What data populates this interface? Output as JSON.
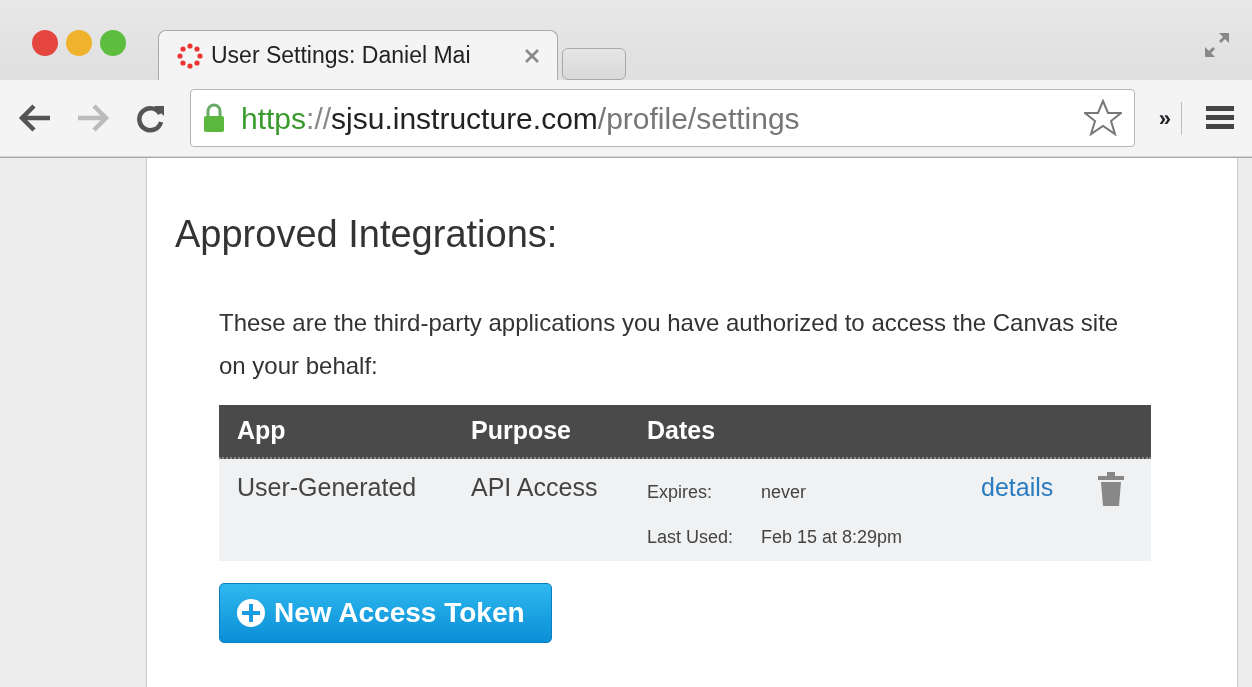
{
  "browser": {
    "tabs": [
      {
        "title": "User Settings: Daniel Mai",
        "selected": true
      }
    ],
    "url": {
      "scheme": "https",
      "separator": "://",
      "host": "sjsu.instructure.com",
      "path": "/profile/settings"
    },
    "back_disabled": false,
    "forward_disabled": true,
    "extensions_label": "»"
  },
  "page": {
    "heading": "Approved Integrations:",
    "description": "These are the third-party applications you have authorized to access the Canvas site on your behalf:",
    "table": {
      "columns": [
        "App",
        "Purpose",
        "Dates"
      ],
      "rows": [
        {
          "app": "User-Generated",
          "purpose": "API Access",
          "dates": [
            {
              "label": "Expires:",
              "value": "never"
            },
            {
              "label": "Last Used:",
              "value": "Feb 15 at 8:29pm"
            }
          ],
          "link": "details"
        }
      ]
    },
    "button": "New Access Token"
  }
}
